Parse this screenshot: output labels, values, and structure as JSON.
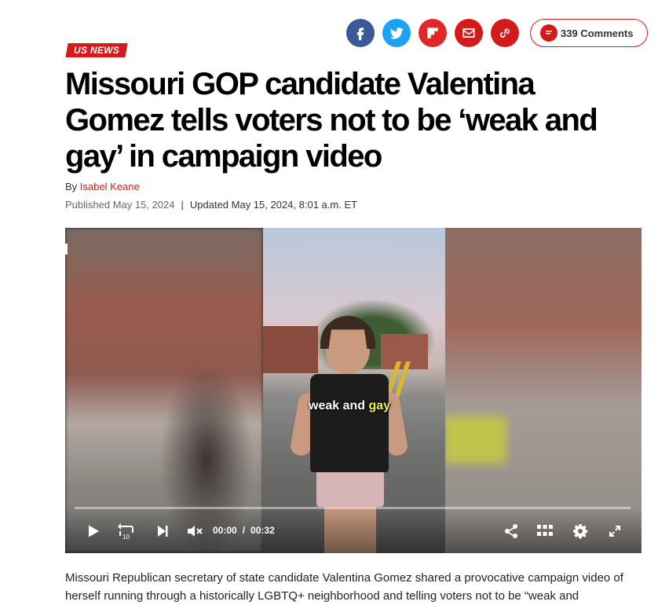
{
  "share": {
    "facebook_icon": "facebook-icon",
    "twitter_icon": "twitter-icon",
    "flipboard_icon": "flipboard-icon",
    "email_icon": "email-icon",
    "link_icon": "link-icon",
    "comments_label": "339 Comments",
    "accent_color": "#d41b1b"
  },
  "article": {
    "section": "US NEWS",
    "headline": "Missouri GOP candidate Valentina Gomez tells voters not to be ‘weak and gay’ in campaign video",
    "byline_prefix": "By",
    "author": "Isabel Keane",
    "published": "Published May 15, 2024",
    "updated": "Updated May 15, 2024, 8:01 a.m. ET",
    "body": "Missouri Republican secretary of state candidate Valentina Gomez shared a provocative campaign video of herself running through a historically LGBTQ+ neighborhood and telling voters not to be “weak and"
  },
  "video": {
    "caption_a": "weak and ",
    "caption_b": "gay",
    "current_time": "00:00",
    "duration": "00:32",
    "progress": 0
  }
}
